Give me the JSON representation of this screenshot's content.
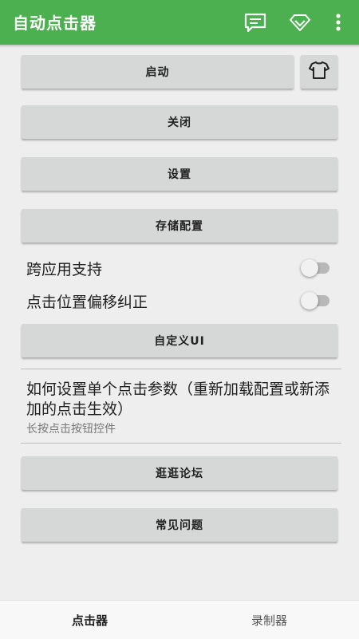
{
  "appbar": {
    "title": "自动点击器",
    "icons": [
      "chat-icon",
      "gem-icon",
      "more-vert-icon"
    ],
    "color": "#4caf50"
  },
  "buttons": {
    "start": "启动",
    "close": "关闭",
    "settings": "设置",
    "save_config": "存储配置",
    "custom_ui": "自定义UI",
    "forum": "逛逛论坛",
    "faq": "常见问题"
  },
  "toggles": {
    "cross_app": {
      "label": "跨应用支持",
      "on": false
    },
    "offset_fix": {
      "label": "点击位置偏移纠正",
      "on": false
    }
  },
  "info": {
    "title": "如何设置单个点击参数（重新加载配置或新添加的点击生效）",
    "subtitle": "长按点击按钮控件"
  },
  "tabs": {
    "clicker": "点击器",
    "recorder": "录制器"
  }
}
